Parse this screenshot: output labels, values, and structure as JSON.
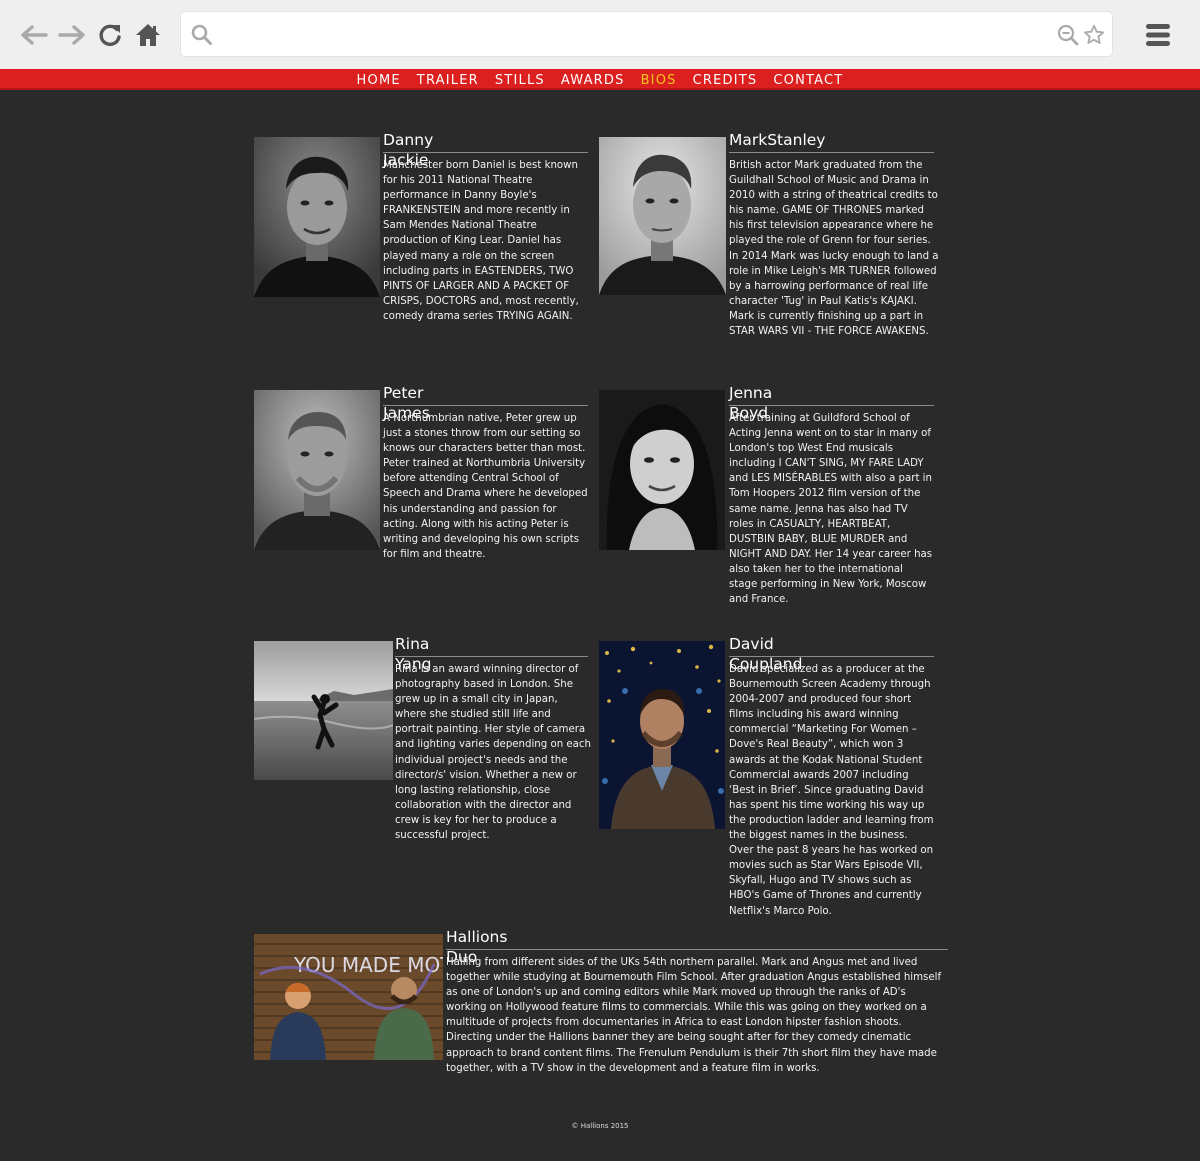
{
  "browser": {
    "back_icon": "arrow-left-icon",
    "forward_icon": "arrow-right-icon",
    "reload_icon": "reload-icon",
    "home_icon": "home-icon",
    "search_icon": "search-icon",
    "zoom_icon": "zoom-out-icon",
    "bookmark_icon": "star-icon",
    "menu_icon": "hamburger-menu-icon",
    "url_value": ""
  },
  "nav": {
    "items": [
      "HOME",
      "TRAILER",
      "STILLS",
      "AWARDS",
      "BIOS",
      "CREDITS",
      "CONTACT"
    ],
    "active": "BIOS",
    "bar_color": "#dc1f1f",
    "active_color": "#f5c518"
  },
  "bios": [
    {
      "name": "Danny Jackie",
      "text": "Manchester born Daniel is best known for his 2011 National Theatre performance in Danny Boyle's FRANKENSTEIN and more recently in Sam Mendes National Theatre production of King Lear. Daniel has played many a role on the screen including parts in EASTENDERS, TWO PINTS OF LARGER AND A PACKET OF CRISPS, DOCTORS and, most recently, comedy drama series TRYING AGAIN."
    },
    {
      "name": "MarkStanley",
      "text": "British actor Mark graduated from the Guildhall School of Music and Drama in 2010 with a string of theatrical credits to his name. GAME OF THRONES marked his first television appearance where he played the role of Grenn for four series. In 2014 Mark was lucky enough to land a role in Mike Leigh's MR TURNER followed by a harrowing performance of real life character 'Tug' in Paul Katis's KAJAKI. Mark is currently finishing up a part in STAR WARS VII - THE FORCE AWAKENS."
    },
    {
      "name": "Peter James",
      "text": "A Northumbrian native, Peter grew up just a stones throw from our setting so knows our characters better than most. Peter trained at Northumbria University before attending Central School of Speech and Drama where he developed his understanding and passion for acting. Along with his acting Peter is writing and developing his own scripts for film and theatre."
    },
    {
      "name": "Jenna Boyd",
      "text": "After training at Guildford School of Acting Jenna went on to star in many of London's top West End musicals including I CAN'T SING, MY FARE LADY and LES MISÉRABLES with also a part in Tom Hoopers 2012 film version of the same name. Jenna has also had TV roles in CASUALTY, HEARTBEAT, DUSTBIN BABY, BLUE MURDER and NIGHT AND DAY. Her 14 year career has also taken her to the international stage performing in New York, Moscow and France."
    },
    {
      "name": "Rina Yang",
      "text": "Rina is an award winning director of photography based in London. She grew up in a small city in Japan, where she studied still life and portrait painting. Her style of camera and lighting varies depending on each individual project's needs and the director/s' vision. Whether a new or long lasting relationship, close collaboration with the director and crew is key for her to produce a successful project."
    },
    {
      "name": "David Coupland",
      "text": "David specialized as a producer at the Bournemouth Screen Academy through 2004-2007 and produced four short films including his award winning commercial “Marketing For Women – Dove's Real Beauty”, which won 3 awards at the Kodak National Student Commercial awards 2007 including ‘Best in Brief’. Since graduating David has spent his time working his way up the production ladder and learning from the biggest names in the business. Over the past 8 years he has worked on movies such as Star Wars Episode VII, Skyfall, Hugo and TV shows such as HBO's Game of Thrones and currently Netflix's Marco Polo."
    },
    {
      "name": "Hallions Duo",
      "text": "Hailing from different sides of the UKs 54th northern parallel. Mark and Angus met and lived together while studying at Bournemouth Film School. After graduation Angus established himself as one of London's up and coming editors while Mark moved up through the ranks of AD's working on Hollywood feature films to commercials. While this was going on they worked on a multitude of projects from documentaries in Africa to east London hipster fashion shoots. Directing under the Hallions banner they are being sought after for they comedy cinematic approach to brand content films. The Frenulum Pendulum is their 7th short film they have made together, with a TV show in the development and a feature film in works.",
      "graffiti": "YOU MADE MOTHER ICK"
    }
  ],
  "footer": "© Hallions 2015"
}
